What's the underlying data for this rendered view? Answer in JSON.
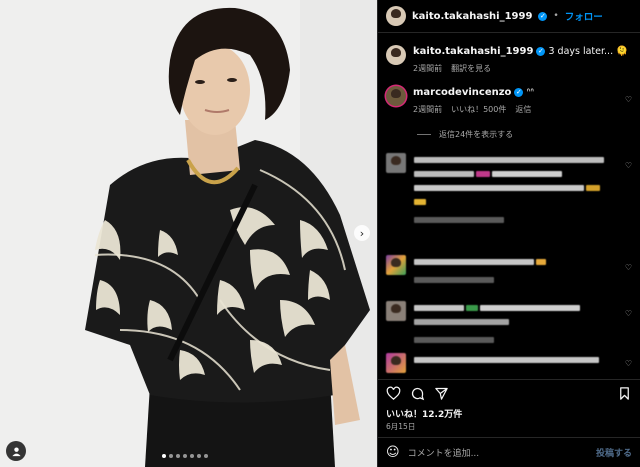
{
  "post": {
    "username": "kaito.takahashi_1999",
    "follow_label": "フォロー",
    "separator": "•"
  },
  "caption": {
    "username": "kaito.takahashi_1999",
    "text": "3 days later...",
    "emoji": "🫠",
    "time": "2週間前",
    "translate": "翻訳を見る"
  },
  "comments": [
    {
      "username": "marcodevincenzo",
      "text": "ᐢᐢ",
      "time": "2週間前",
      "likes": "いいね！500件",
      "reply": "返信",
      "view_replies": "返信24件を表示する"
    }
  ],
  "media": {
    "slide_count": 7,
    "current_slide": 1,
    "next_icon": "chevron-right-icon",
    "user_tag_icon": "person-icon"
  },
  "engagement": {
    "likes": "いいね！12.2万件",
    "date": "6月15日"
  },
  "composer": {
    "placeholder": "コメントを追加...",
    "post_label": "投稿する"
  },
  "colors": {
    "accent": "#0095f6",
    "background": "#000000",
    "muted_text": "#a8a8a8"
  }
}
